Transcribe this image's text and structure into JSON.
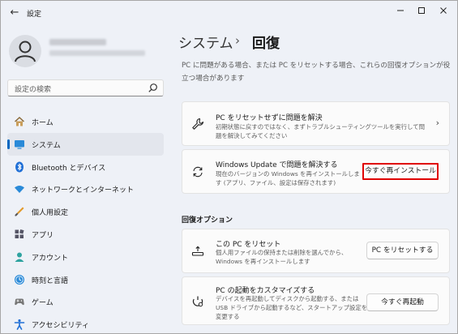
{
  "window": {
    "title": "設定"
  },
  "window_controls": [
    "minimize",
    "maximize",
    "close"
  ],
  "search": {
    "placeholder": "設定の検索"
  },
  "nav": {
    "items": [
      {
        "label": "ホーム",
        "icon": "home-icon"
      },
      {
        "label": "システム",
        "icon": "system-icon",
        "selected": true
      },
      {
        "label": "Bluetooth とデバイス",
        "icon": "bluetooth-icon"
      },
      {
        "label": "ネットワークとインターネット",
        "icon": "network-icon"
      },
      {
        "label": "個人用設定",
        "icon": "personalization-icon"
      },
      {
        "label": "アプリ",
        "icon": "apps-icon"
      },
      {
        "label": "アカウント",
        "icon": "account-icon"
      },
      {
        "label": "時刻と言語",
        "icon": "time-language-icon"
      },
      {
        "label": "ゲーム",
        "icon": "gaming-icon"
      },
      {
        "label": "アクセシビリティ",
        "icon": "accessibility-icon"
      }
    ]
  },
  "breadcrumb": {
    "parent": "システム",
    "separator": "›",
    "current": "回復"
  },
  "description": "PC に問題がある場合、または PC をリセットする場合、これらの回復オプションが役立つ場合があります",
  "cards": {
    "troubleshoot": {
      "title": "PC をリセットせずに問題を解決",
      "subtitle": "初期状態に戻すのではなく、まずトラブルシューティングツールを実行して問題を解決してみてください",
      "icon": "wrench-icon"
    },
    "windows_update": {
      "title": "Windows Update で問題を解決する",
      "subtitle": "現在のバージョンの Windows を再インストールします (アプリ、ファイル、設定は保存されます)",
      "button": "今すぐ再インストール",
      "icon": "sync-icon"
    }
  },
  "recovery_options": {
    "label": "回復オプション",
    "reset": {
      "title": "この PC をリセット",
      "subtitle": "個人用ファイルの保持または削除を選んでから、Windows を再インストールします",
      "button": "PC をリセットする",
      "icon": "reset-pc-icon"
    },
    "advanced_startup": {
      "title": "PC の起動をカスタマイズする",
      "subtitle": "デバイスを再起動してディスクから起動する、または USB ドライブから起動するなど、スタートアップ設定を変更する",
      "button": "今すぐ再起動",
      "icon": "advanced-startup-icon"
    }
  },
  "colors": {
    "accent": "#0067c0",
    "highlight_border": "#e00000",
    "window_bg": "#eef1f7",
    "card_bg": "#fbfbfb"
  }
}
